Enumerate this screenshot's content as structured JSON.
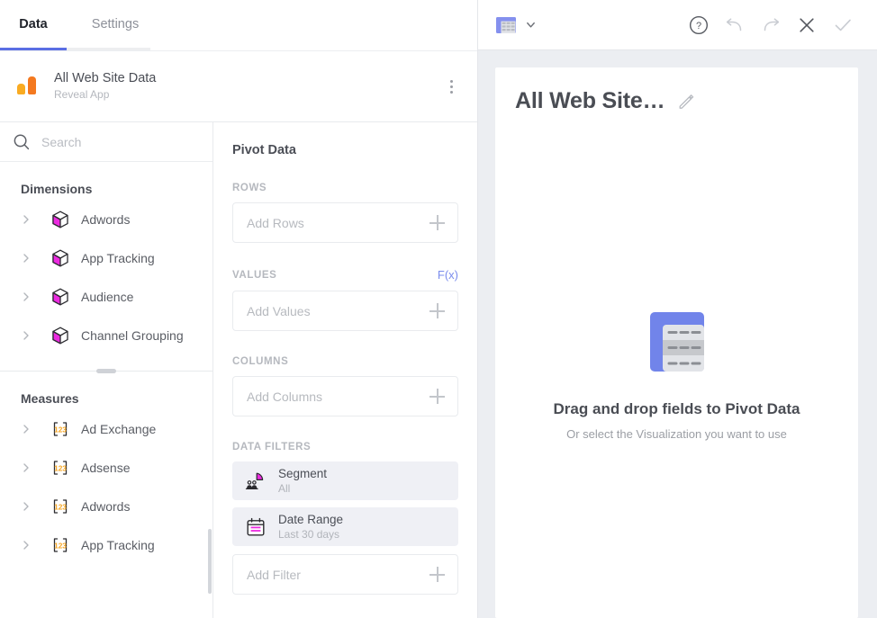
{
  "tabs": [
    {
      "label": "Data",
      "active": true
    },
    {
      "label": "Settings",
      "active": false
    }
  ],
  "source": {
    "icon": "google-analytics-logo",
    "title": "All Web Site Data",
    "subtitle": "Reveal App",
    "menu_icon": "kebab-menu-icon"
  },
  "search": {
    "placeholder": "Search",
    "value": "",
    "icon": "search-icon"
  },
  "dimensions": {
    "title": "Dimensions",
    "items": [
      {
        "label": "Adwords",
        "icon": "cube-icon"
      },
      {
        "label": "App Tracking",
        "icon": "cube-icon"
      },
      {
        "label": "Audience",
        "icon": "cube-icon"
      },
      {
        "label": "Channel Grouping",
        "icon": "cube-icon"
      }
    ]
  },
  "measures": {
    "title": "Measures",
    "items": [
      {
        "label": "Ad Exchange",
        "icon": "numeric-123-icon"
      },
      {
        "label": "Adsense",
        "icon": "numeric-123-icon"
      },
      {
        "label": "Adwords",
        "icon": "numeric-123-icon"
      },
      {
        "label": "App Tracking",
        "icon": "numeric-123-icon"
      }
    ]
  },
  "pivot": {
    "title": "Pivot Data",
    "rows": {
      "label": "ROWS",
      "placeholder": "Add Rows"
    },
    "values": {
      "label": "VALUES",
      "placeholder": "Add Values",
      "fx": "F(x)"
    },
    "columns": {
      "label": "COLUMNS",
      "placeholder": "Add Columns"
    },
    "data_filters": {
      "label": "DATA FILTERS",
      "items": [
        {
          "name": "Segment",
          "value": "All",
          "icon": "segment-pie-people-icon"
        },
        {
          "name": "Date Range",
          "value": "Last 30 days",
          "icon": "calendar-icon"
        }
      ],
      "add_placeholder": "Add Filter"
    }
  },
  "toolbar": {
    "viz_icon": "pivot-table-icon",
    "viz_chevron": "chevron-down-icon",
    "help_label": "?",
    "actions": [
      {
        "name": "help",
        "icon": "help-circle-icon"
      },
      {
        "name": "undo",
        "icon": "undo-arrow-icon"
      },
      {
        "name": "redo",
        "icon": "redo-arrow-icon"
      },
      {
        "name": "close",
        "icon": "close-x-icon"
      },
      {
        "name": "confirm",
        "icon": "checkmark-icon"
      }
    ]
  },
  "canvas": {
    "title": "All Web Site…",
    "edit_icon": "pencil-icon",
    "empty_heading": "Drag and drop fields to Pivot Data",
    "empty_sub": "Or select the Visualization you want to use",
    "empty_art": "pivot-table-illustration"
  },
  "colors": {
    "accent_blue": "#5b6ee4",
    "link_blue": "#7b8ced",
    "magenta": "#ec2ae0",
    "orange": "#f4791f",
    "amber": "#f9ab22",
    "chip_bg": "#eff0f5",
    "canvas_bg": "#eceef2"
  }
}
